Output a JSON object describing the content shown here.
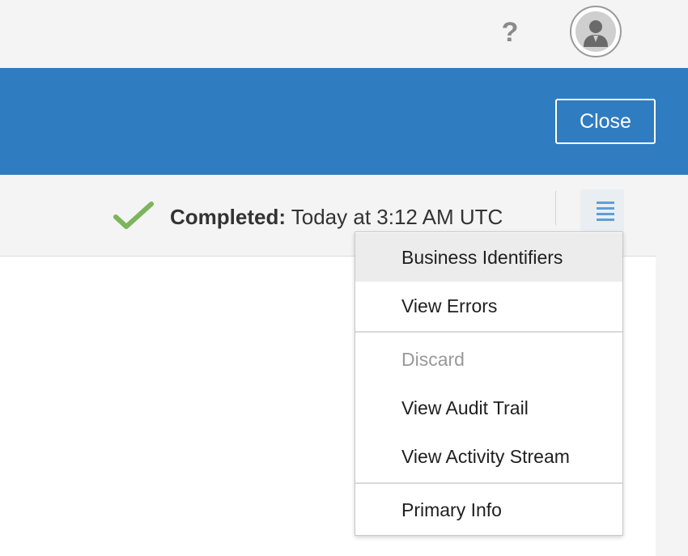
{
  "header": {
    "help_label": "?"
  },
  "banner": {
    "close_label": "Close"
  },
  "status": {
    "state_label": "Completed:",
    "time_text": " Today at 3:12 AM UTC"
  },
  "menu": {
    "items": [
      {
        "label": "Business Identifiers"
      },
      {
        "label": "View Errors"
      },
      {
        "label": "Discard"
      },
      {
        "label": "View Audit Trail"
      },
      {
        "label": "View Activity Stream"
      },
      {
        "label": "Primary Info"
      }
    ]
  },
  "colors": {
    "banner": "#2f7cc1",
    "success": "#7cb55a",
    "menu_icon": "#5f9fd6"
  },
  "icons": [
    "help-icon",
    "avatar-icon",
    "check-icon",
    "menu-icon"
  ]
}
